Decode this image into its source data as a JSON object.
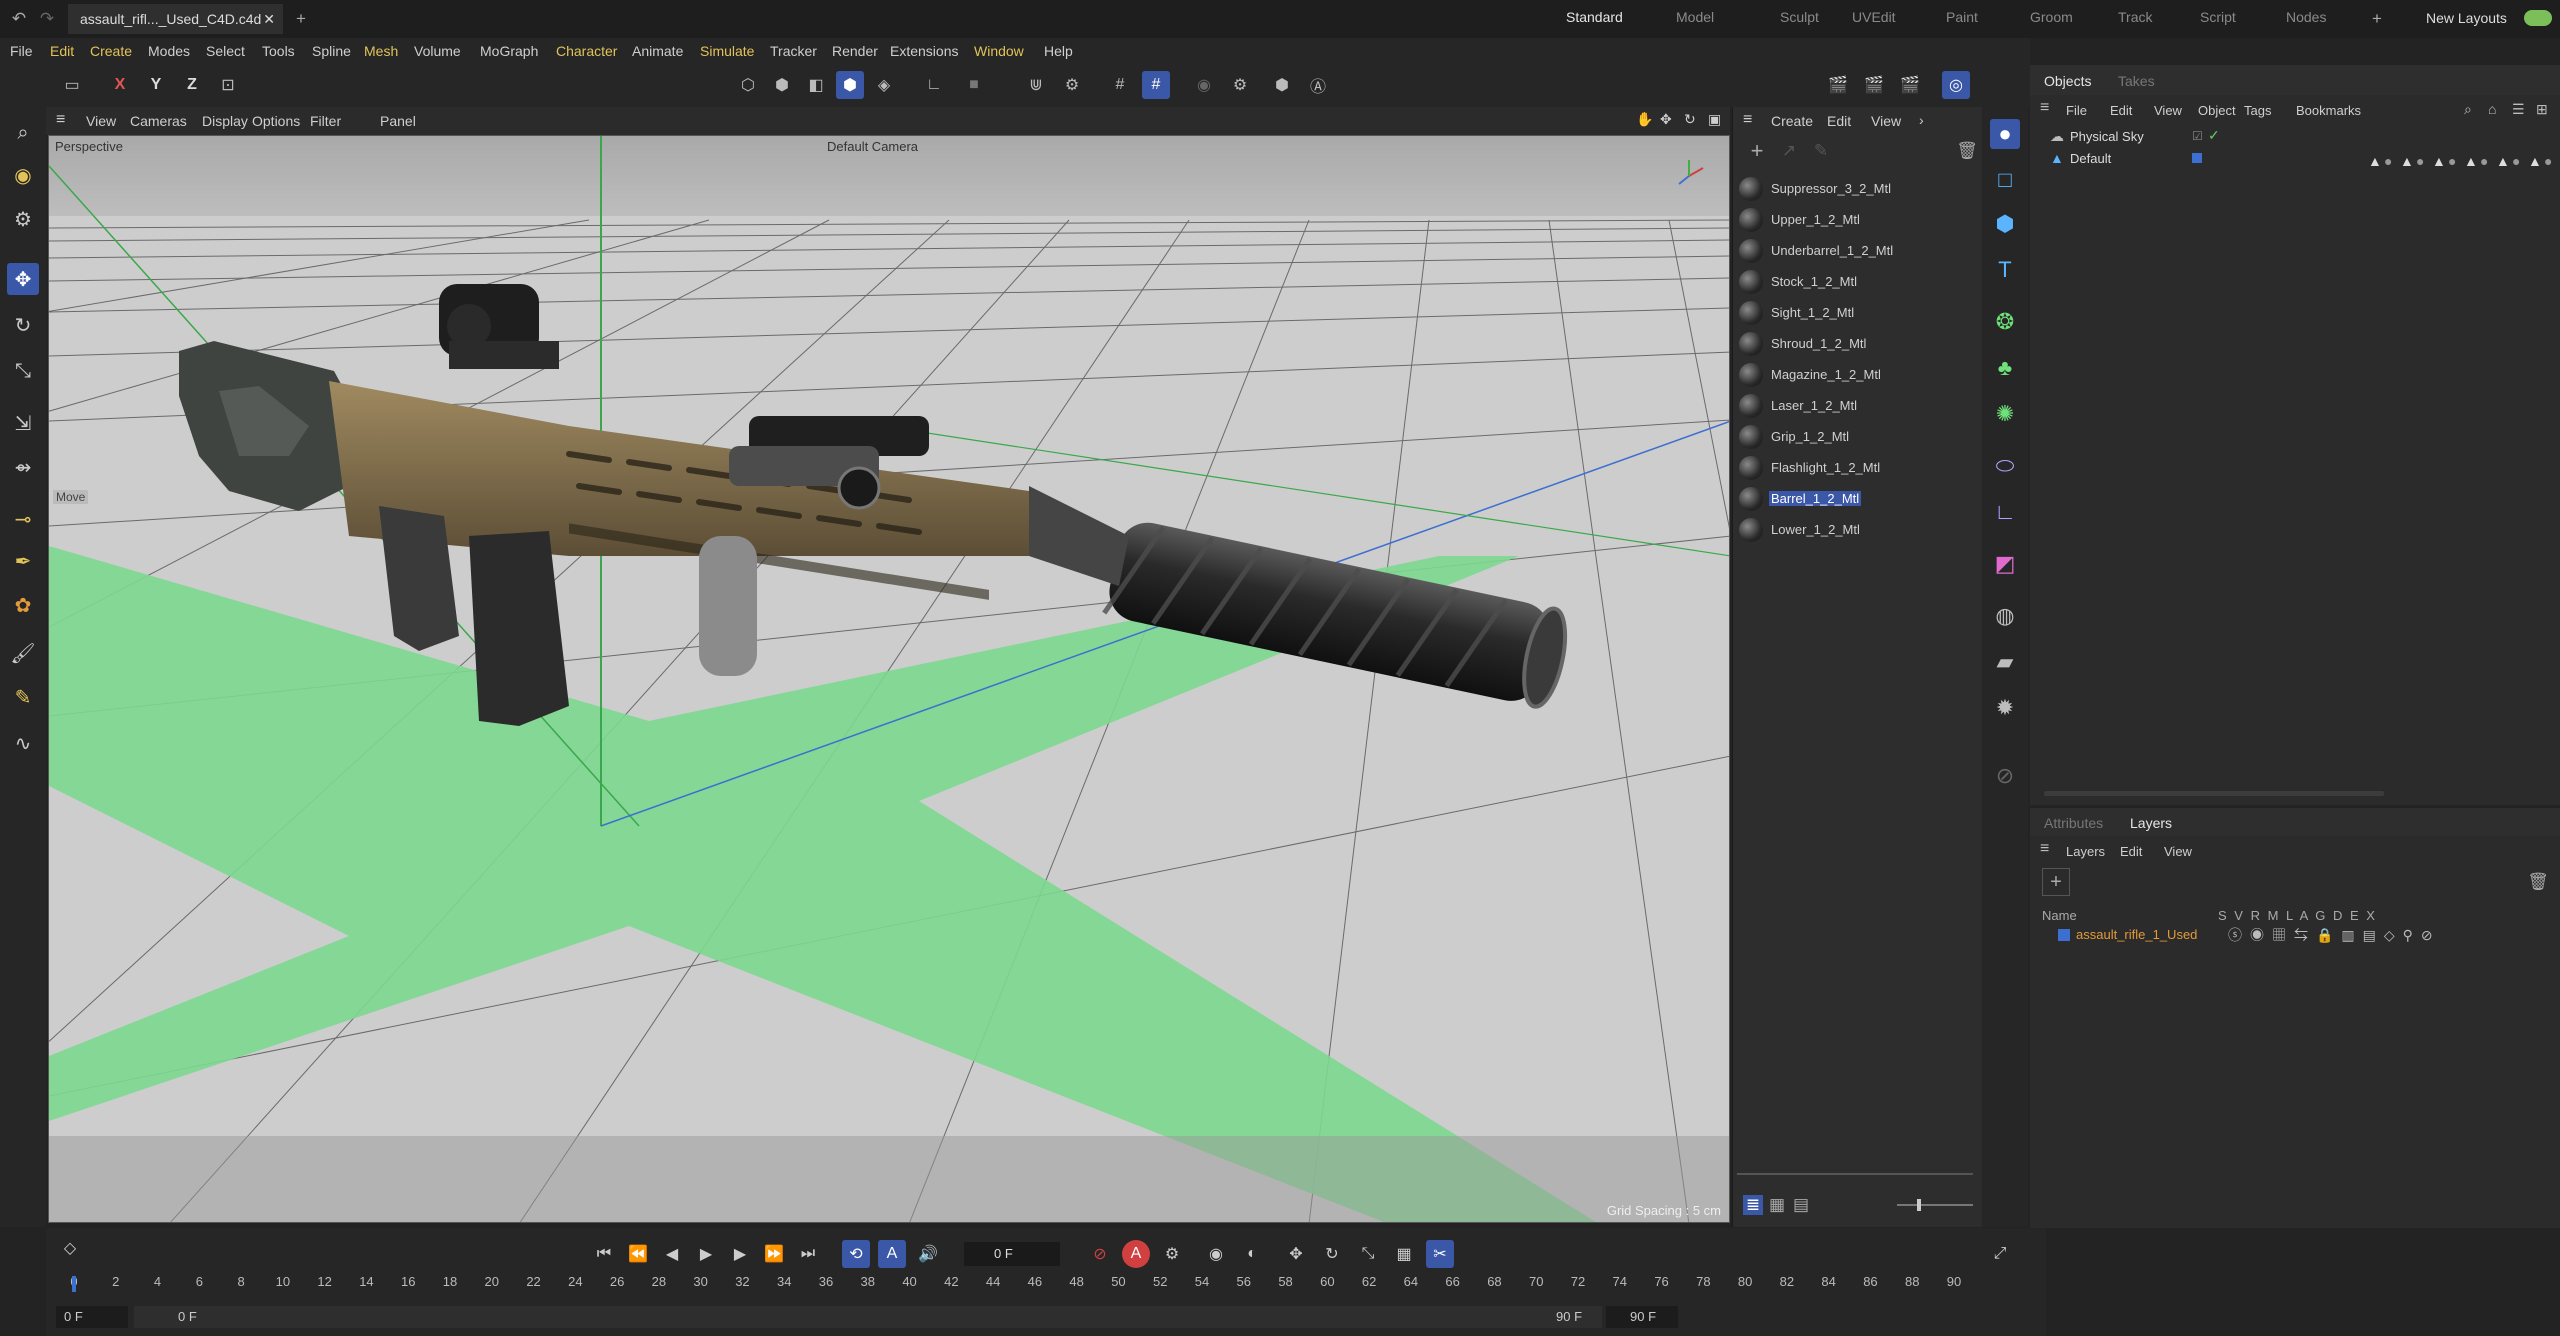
{
  "titlebar": {
    "file_tab": "assault_rifl..._Used_C4D.c4d",
    "close": "✕",
    "add": "+",
    "layouts": [
      "Standard",
      "Model",
      "Sculpt",
      "UVEdit",
      "Paint",
      "Groom",
      "Track",
      "Script",
      "Nodes"
    ],
    "active_layout": "Standard",
    "new_layouts": "New Layouts"
  },
  "menubar": [
    {
      "label": "File",
      "hl": false
    },
    {
      "label": "Edit",
      "hl": true
    },
    {
      "label": "Create",
      "hl": true
    },
    {
      "label": "Modes",
      "hl": false
    },
    {
      "label": "Select",
      "hl": false
    },
    {
      "label": "Tools",
      "hl": false
    },
    {
      "label": "Spline",
      "hl": false
    },
    {
      "label": "Mesh",
      "hl": true
    },
    {
      "label": "Volume",
      "hl": false
    },
    {
      "label": "MoGraph",
      "hl": false
    },
    {
      "label": "Character",
      "hl": true
    },
    {
      "label": "Animate",
      "hl": false
    },
    {
      "label": "Simulate",
      "hl": true
    },
    {
      "label": "Tracker",
      "hl": false
    },
    {
      "label": "Render",
      "hl": false
    },
    {
      "label": "Extensions",
      "hl": false
    },
    {
      "label": "Window",
      "hl": true
    },
    {
      "label": "Help",
      "hl": false
    }
  ],
  "axes": {
    "x": "X",
    "y": "Y",
    "z": "Z"
  },
  "viewport": {
    "menu": [
      "View",
      "Cameras",
      "Display",
      "Options",
      "Filter",
      "Panel"
    ],
    "label": "Perspective",
    "camera": "Default Camera",
    "move_label": "Move",
    "grid_spacing": "Grid Spacing : 5 cm"
  },
  "materials": {
    "menu": [
      "Create",
      "Edit",
      "View"
    ],
    "items": [
      {
        "name": "Suppressor_3_2_Mtl",
        "selected": false
      },
      {
        "name": "Upper_1_2_Mtl",
        "selected": false
      },
      {
        "name": "Underbarrel_1_2_Mtl",
        "selected": false
      },
      {
        "name": "Stock_1_2_Mtl",
        "selected": false
      },
      {
        "name": "Sight_1_2_Mtl",
        "selected": false
      },
      {
        "name": "Shroud_1_2_Mtl",
        "selected": false
      },
      {
        "name": "Magazine_1_2_Mtl",
        "selected": false
      },
      {
        "name": "Laser_1_2_Mtl",
        "selected": false
      },
      {
        "name": "Grip_1_2_Mtl",
        "selected": false
      },
      {
        "name": "Flashlight_1_2_Mtl",
        "selected": false
      },
      {
        "name": "Barrel_1_2_Mtl",
        "selected": true
      },
      {
        "name": "Lower_1_2_Mtl",
        "selected": false
      }
    ]
  },
  "objects": {
    "tabs": [
      "Objects",
      "Takes"
    ],
    "menu": [
      "File",
      "Edit",
      "View",
      "Object",
      "Tags",
      "Bookmarks"
    ],
    "items": [
      {
        "name": "Physical Sky"
      },
      {
        "name": "Default"
      }
    ]
  },
  "layers": {
    "tabs": [
      "Attributes",
      "Layers"
    ],
    "menu": [
      "Layers",
      "Edit",
      "View"
    ],
    "col_name": "Name",
    "col_flags": "S V R M L A G D E X",
    "items": [
      {
        "name": "assault_rifle_1_Used"
      }
    ]
  },
  "timeline": {
    "current_frame": "0 F",
    "ticks": [
      "0",
      "2",
      "4",
      "6",
      "8",
      "10",
      "12",
      "14",
      "16",
      "18",
      "20",
      "22",
      "24",
      "26",
      "28",
      "30",
      "32",
      "34",
      "36",
      "38",
      "40",
      "42",
      "44",
      "46",
      "48",
      "50",
      "52",
      "54",
      "56",
      "58",
      "60",
      "62",
      "64",
      "66",
      "68",
      "70",
      "72",
      "74",
      "76",
      "78",
      "80",
      "82",
      "84",
      "86",
      "88",
      "90"
    ],
    "start": "0 F",
    "start2": "0 F",
    "end": "90 F",
    "end2": "90 F"
  },
  "colors": {
    "accent": "#3b57a8",
    "highlight": "#e2c35a",
    "grid_green": "#7cd88f"
  }
}
